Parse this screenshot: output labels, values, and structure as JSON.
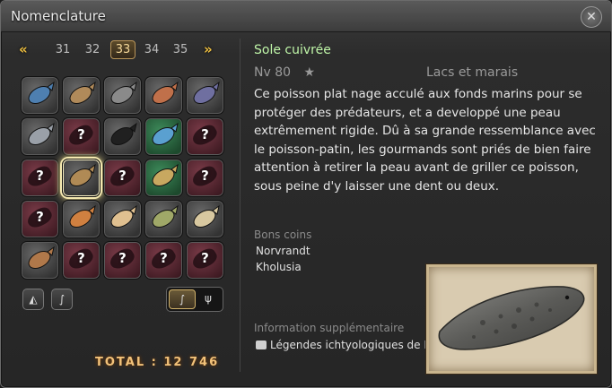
{
  "window": {
    "title": "Nomenclature"
  },
  "pager": {
    "prev": "«",
    "next": "»",
    "pages": [
      "31",
      "32",
      "33",
      "34",
      "35"
    ],
    "active": "33"
  },
  "grid": [
    [
      "found",
      "found",
      "found",
      "found",
      "found"
    ],
    [
      "found",
      "unknown",
      "found",
      "hq",
      "unknown"
    ],
    [
      "unknown",
      "selected",
      "unknown",
      "hq",
      "unknown"
    ],
    [
      "unknown",
      "found",
      "found",
      "found",
      "found"
    ],
    [
      "found",
      "unknown",
      "unknown",
      "unknown",
      "unknown"
    ]
  ],
  "unknown_mark": "?",
  "total": "TOTAL : 12 746",
  "fish": {
    "name": "Sole cuivrée",
    "level": "Nv 80",
    "star": "★",
    "habitat": "Lacs et marais",
    "description": "Ce poisson plat nage acculé aux fonds marins pour se protéger des prédateurs, et a developpé une peau extrêmement rigide. Dû à sa grande ressemblance avec le poisson-patin, les gourmands sont priés de bien faire attention à retirer la peau avant de griller ce poisson, sous peine d'y laisser une dent ou deux.",
    "spots_label": "Bons coins",
    "spots": [
      "Norvrandt",
      "Kholusia"
    ],
    "extra_label": "Information supplémentaire",
    "extra_source": "Légendes ichtyologiques de Norv"
  },
  "colors": {
    "accent": "#f0c040",
    "name": "#bff5a8"
  }
}
